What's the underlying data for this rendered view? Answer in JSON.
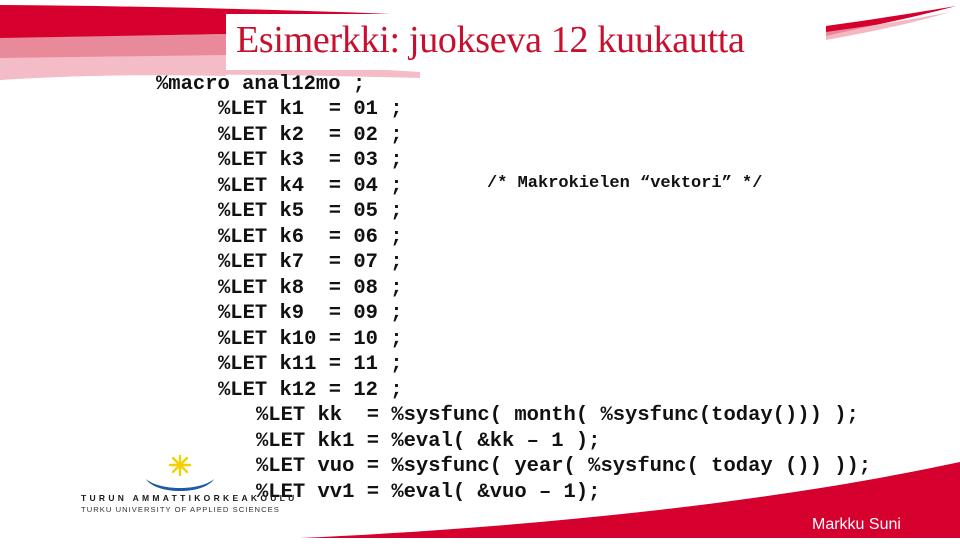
{
  "slide": {
    "title": "Esimerkki: juokseva 12 kuukautta",
    "code_lines": [
      "%macro anal12mo ;",
      "%LET k1  = 01 ;",
      "%LET k2  = 02 ;",
      "%LET k3  = 03 ;",
      "%LET k4  = 04 ;",
      "%LET k5  = 05 ;",
      "%LET k6  = 06 ;",
      "%LET k7  = 07 ;",
      "%LET k8  = 08 ;",
      "%LET k9  = 09 ;",
      "%LET k10 = 10 ;",
      "%LET k11 = 11 ;",
      "%LET k12 = 12 ;",
      "%LET kk  = %sysfunc( month( %sysfunc(today())) );",
      "%LET kk1 = %eval( &kk – 1 );",
      "%LET vuo = %sysfunc( year( %sysfunc( today ()) ));",
      "%LET vv1 = %eval( &vuo – 1);"
    ],
    "comment": "/* Makrokielen “vektori” */"
  },
  "logo": {
    "name_fi": "TURUN AMMATTIKORKEAKOULU",
    "name_en": "TURKU UNIVERSITY OF APPLIED SCIENCES",
    "icon": "sun-over-bowl-logo"
  },
  "footer": {
    "author": "Markku Suni"
  },
  "colors": {
    "brand_red": "#c8102e",
    "band_mid": "#e88a9a",
    "band_light": "#f4bcc6",
    "logo_blue": "#1f5aa6",
    "logo_yellow": "#f5d000"
  }
}
